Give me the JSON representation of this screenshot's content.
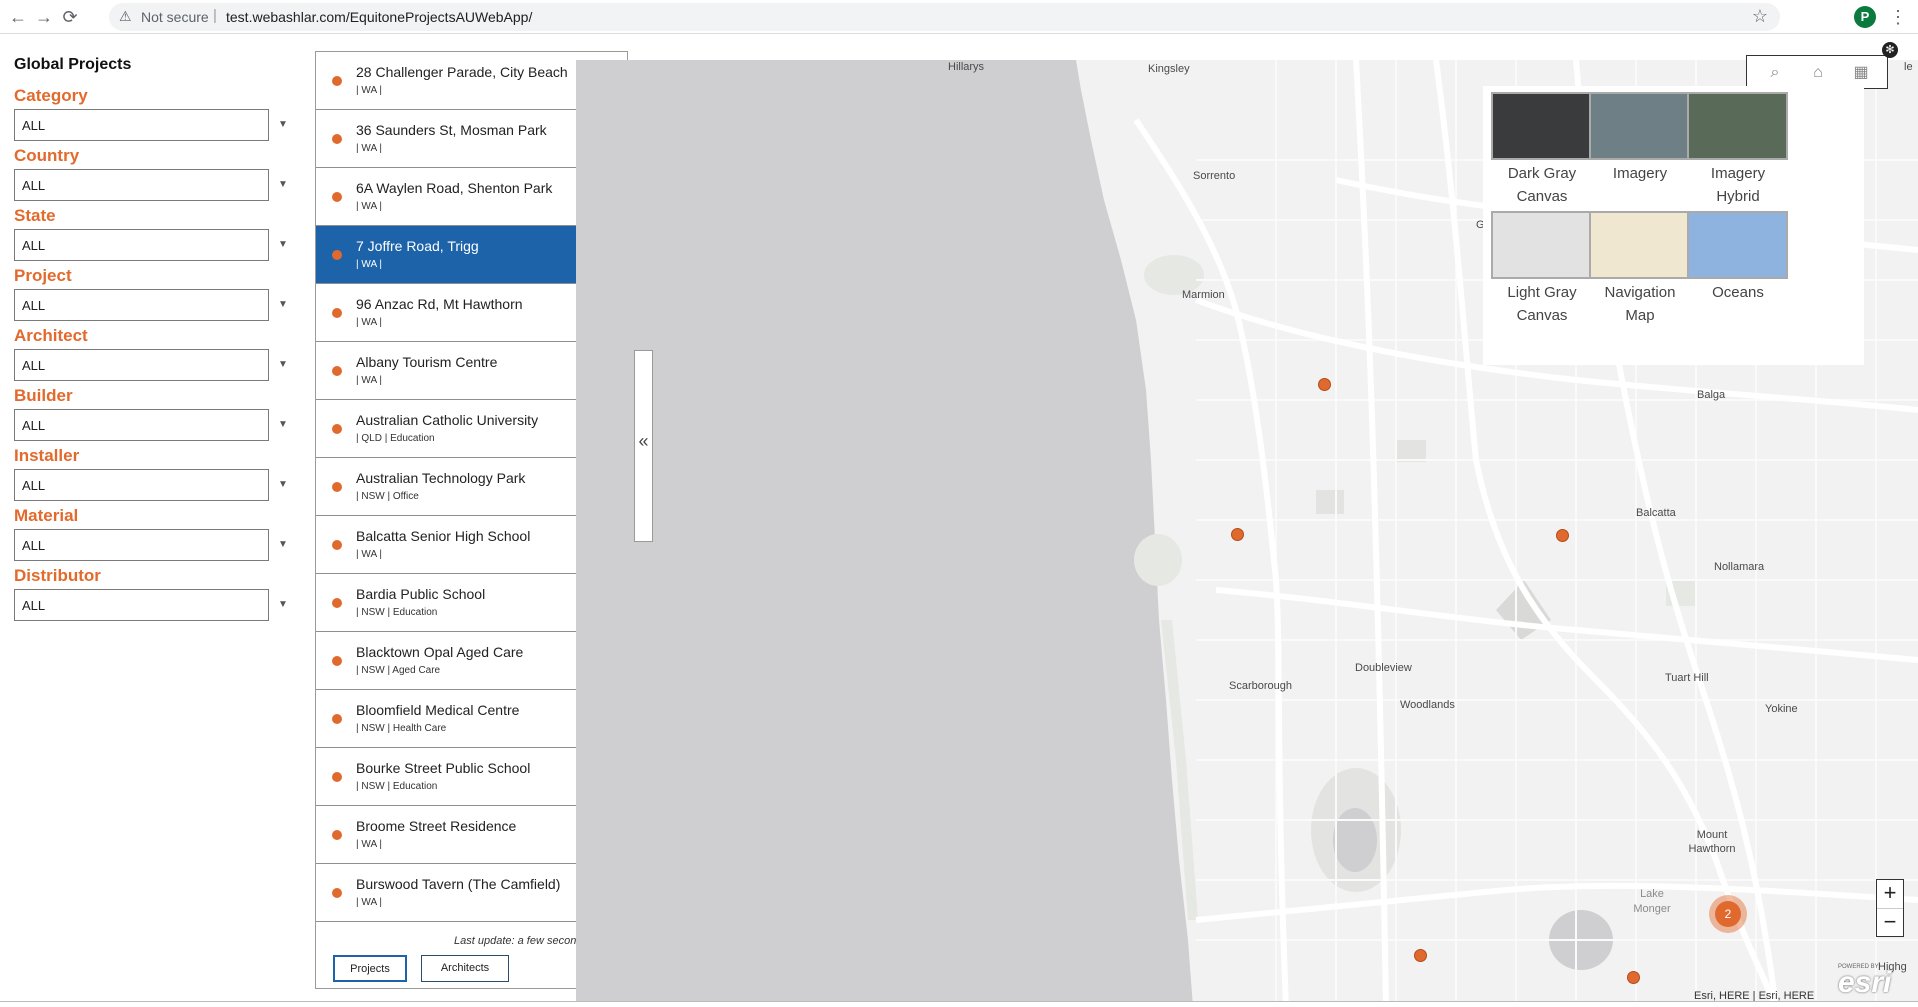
{
  "browser": {
    "back_icon": "arrow-left-icon",
    "forward_icon": "arrow-right-icon",
    "reload_icon": "reload-icon",
    "warning_icon": "warning-triangle-icon",
    "security_label": "Not secure",
    "separator": "|",
    "url": "test.webashlar.com/EquitoneProjectsAUWebApp/",
    "profile_initial": "P"
  },
  "panel_title": "Global Projects",
  "filters": [
    {
      "label": "Category",
      "value": "ALL"
    },
    {
      "label": "Country",
      "value": "ALL"
    },
    {
      "label": "State",
      "value": "ALL"
    },
    {
      "label": "Project",
      "value": "ALL"
    },
    {
      "label": "Architect",
      "value": "ALL"
    },
    {
      "label": "Builder",
      "value": "ALL"
    },
    {
      "label": "Installer",
      "value": "ALL"
    },
    {
      "label": "Material",
      "value": "ALL"
    },
    {
      "label": "Distributor",
      "value": "ALL"
    }
  ],
  "projects": [
    {
      "title": "28 Challenger Parade, City Beach",
      "sub": "| WA |"
    },
    {
      "title": "36 Saunders St, Mosman Park",
      "sub": "| WA |"
    },
    {
      "title": "6A Waylen Road, Shenton Park",
      "sub": "| WA |"
    },
    {
      "title": "7 Joffre Road, Trigg",
      "sub": "| WA |",
      "selected": true
    },
    {
      "title": "96 Anzac Rd, Mt Hawthorn",
      "sub": "| WA |"
    },
    {
      "title": "Albany Tourism Centre",
      "sub": "| WA |"
    },
    {
      "title": "Australian Catholic University",
      "sub": "| QLD | Education"
    },
    {
      "title": "Australian Technology Park",
      "sub": "| NSW | Office"
    },
    {
      "title": "Balcatta Senior High School",
      "sub": "| WA |"
    },
    {
      "title": "Bardia Public School",
      "sub": "| NSW | Education"
    },
    {
      "title": "Blacktown Opal Aged Care",
      "sub": "| NSW | Aged Care"
    },
    {
      "title": "Bloomfield Medical Centre",
      "sub": "| NSW | Health Care"
    },
    {
      "title": "Bourke Street Public School",
      "sub": "| NSW | Education"
    },
    {
      "title": "Broome Street Residence",
      "sub": "| WA |"
    },
    {
      "title": "Burswood Tavern (The Camfield)",
      "sub": "| WA |"
    }
  ],
  "last_update": "Last update: a few seconds ago",
  "tabs": {
    "projects": "Projects",
    "architects": "Architects"
  },
  "collapse_glyph": "«",
  "map": {
    "labels": [
      "Hillarys",
      "Kingsley",
      "Sorrento",
      "Marmion",
      "Balga",
      "Balcatta",
      "Nollamara",
      "Doubleview",
      "Scarborough",
      "Woodlands",
      "Tuart Hill",
      "Yokine",
      "Mount Hawthorn",
      "Lake Monger",
      "Highg",
      "le",
      "G"
    ],
    "cluster_count": "2",
    "attribution": "Esri, HERE | Esri, HERE",
    "esri_logo": "esri",
    "powered_by": "POWERED BY",
    "zoom_in": "+",
    "zoom_out": "−"
  },
  "basemaps": [
    {
      "label": "Dark Gray Canvas",
      "color": "#3a3b3d"
    },
    {
      "label": "Imagery",
      "color": "#6e7f86"
    },
    {
      "label": "Imagery Hybrid",
      "color": "#5a6a58"
    },
    {
      "label": "Light Gray Canvas",
      "color": "#e2e2e2"
    },
    {
      "label": "Navigation Map",
      "color": "#efe7cf"
    },
    {
      "label": "Oceans",
      "color": "#8fb3df"
    }
  ],
  "colors": {
    "accent": "#e26a2c",
    "selected_row": "#1c63aa",
    "water": "#cfcfd1",
    "land": "#f2f2f2"
  }
}
